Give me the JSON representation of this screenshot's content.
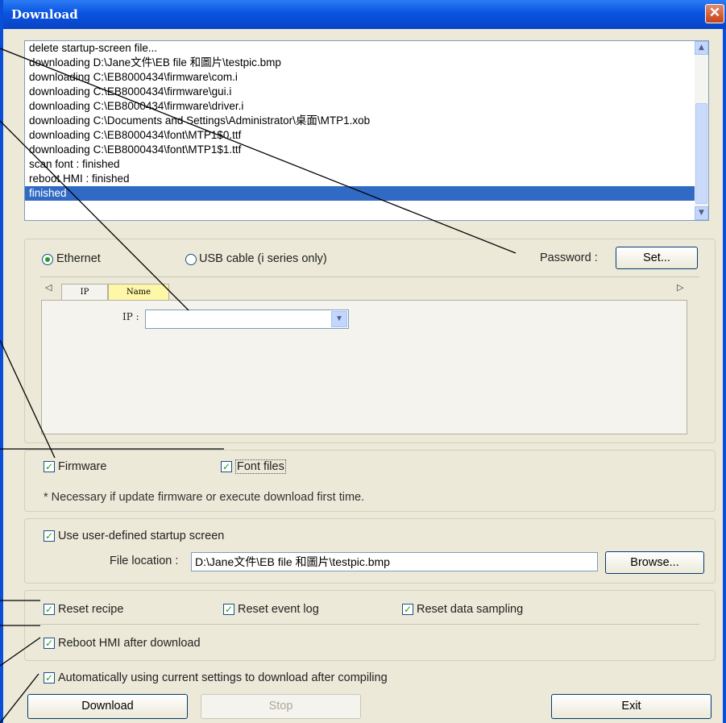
{
  "window": {
    "title": "Download",
    "close_icon": "close-icon"
  },
  "log": {
    "lines": [
      "delete startup-screen file...",
      "downloading D:\\Jane文件\\EB file 和圖片\\testpic.bmp",
      "downloading C:\\EB8000434\\firmware\\com.i",
      "downloading C:\\EB8000434\\firmware\\gui.i",
      "downloading C:\\EB8000434\\firmware\\driver.i",
      "downloading C:\\Documents and Settings\\Administrator\\桌面\\MTP1.xob",
      "downloading C:\\EB8000434\\font\\MTP1$0.ttf",
      "downloading C:\\EB8000434\\font\\MTP1$1.ttf",
      "scan font : finished",
      "reboot HMI : finished",
      "finished"
    ],
    "selected_index": 10
  },
  "connection": {
    "ethernet_label": "Ethernet",
    "usb_label": "USB cable (i series only)",
    "selected": "ethernet",
    "password_label": "Password :",
    "set_button": "Set...",
    "tabs": [
      "IP",
      "Name"
    ],
    "active_tab": "IP",
    "ip_label": "IP :",
    "ip_value": ""
  },
  "files": {
    "firmware_label": "Firmware",
    "firmware_checked": true,
    "font_label": "Font files",
    "font_checked": true,
    "note": "* Necessary if update firmware or execute download first time."
  },
  "startup": {
    "use_label": "Use user-defined startup screen",
    "use_checked": true,
    "file_location_label": "File location :",
    "file_location_value": "D:\\Jane文件\\EB file 和圖片\\testpic.bmp",
    "browse_button": "Browse..."
  },
  "options": {
    "reset_recipe": "Reset recipe",
    "reset_event_log": "Reset event log",
    "reset_data_sampling": "Reset data sampling",
    "reboot": "Reboot HMI after download",
    "auto": "Automatically using current settings to download after compiling"
  },
  "buttons": {
    "download": "Download",
    "stop": "Stop",
    "exit": "Exit"
  },
  "colors": {
    "title_bar": "#0a54e0",
    "selection": "#316ac5",
    "check": "#21a121",
    "annotation": "#000000"
  }
}
